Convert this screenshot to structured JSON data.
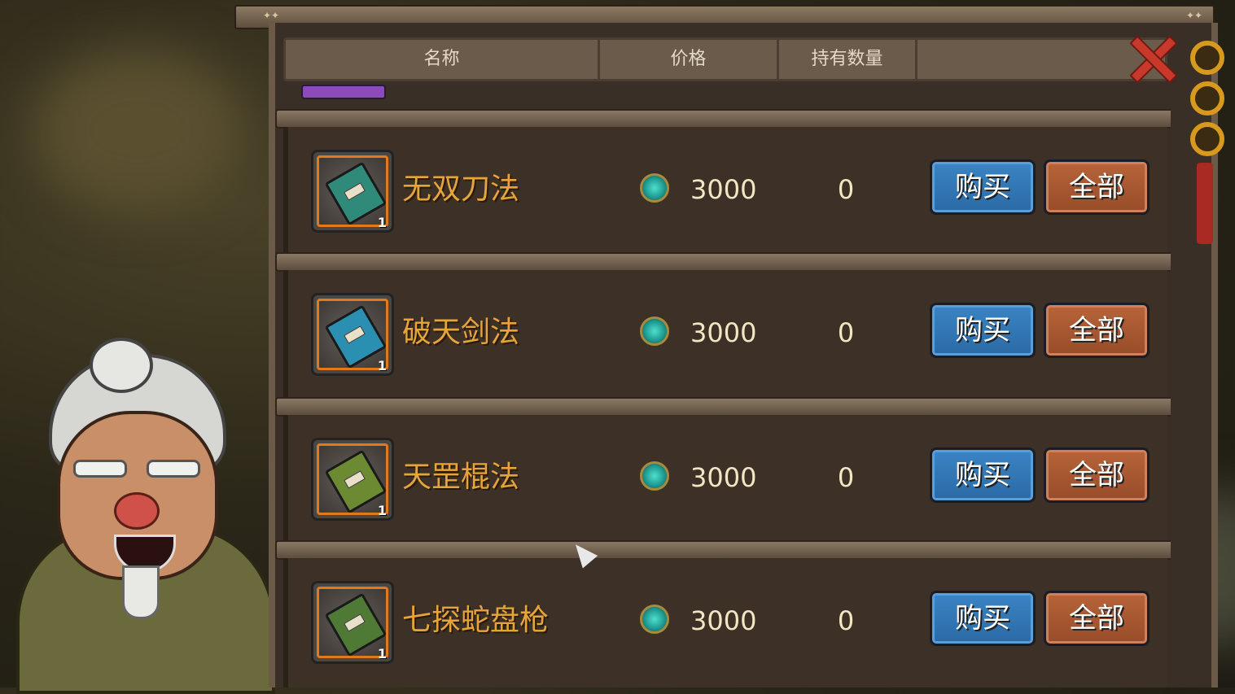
{
  "header": {
    "col_name": "名称",
    "col_price": "价格",
    "col_owned": "持有数量"
  },
  "items": [
    {
      "name": "无双刀法",
      "price": "3000",
      "owned": "0",
      "count": "1",
      "book_color": "#2f8a7a",
      "buy_label": "购买",
      "all_label": "全部"
    },
    {
      "name": "破天剑法",
      "price": "3000",
      "owned": "0",
      "count": "1",
      "book_color": "#2a8fb0",
      "buy_label": "购买",
      "all_label": "全部"
    },
    {
      "name": "天罡棍法",
      "price": "3000",
      "owned": "0",
      "count": "1",
      "book_color": "#6c8a32",
      "buy_label": "购买",
      "all_label": "全部"
    },
    {
      "name": "七探蛇盘枪",
      "price": "3000",
      "owned": "0",
      "count": "1",
      "book_color": "#4f7a36",
      "buy_label": "购买",
      "all_label": "全部"
    }
  ],
  "colors": {
    "name_text": "#e6a53a",
    "buy_button": "#2a6aa6",
    "all_button": "#974c28",
    "close_icon": "#c8392b"
  },
  "icons": {
    "currency": "jade-coin-icon",
    "close": "close-icon",
    "item": "book-icon"
  }
}
